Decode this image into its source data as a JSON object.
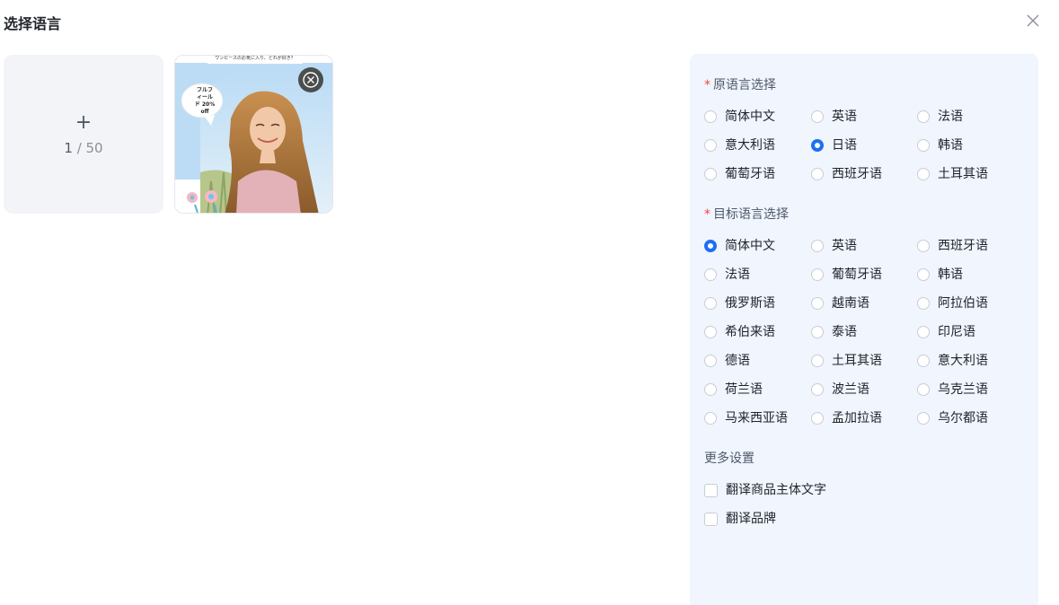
{
  "dialog": {
    "title": "选择语言"
  },
  "upload": {
    "plus": "+",
    "count_current": "1",
    "separator": " / ",
    "count_max": "50"
  },
  "thumbnail": {
    "top_text": "ワンピースのお気に入り、どれが好き？",
    "bubble_lines": [
      "フルフ",
      "ィール",
      "ド 20%",
      "off"
    ]
  },
  "source_language": {
    "required_mark": "*",
    "label": "原语言选择",
    "selected": "日语",
    "options": [
      "简体中文",
      "英语",
      "法语",
      "意大利语",
      "日语",
      "韩语",
      "葡萄牙语",
      "西班牙语",
      "土耳其语"
    ]
  },
  "target_language": {
    "required_mark": "*",
    "label": "目标语言选择",
    "selected": "简体中文",
    "options": [
      "简体中文",
      "英语",
      "西班牙语",
      "法语",
      "葡萄牙语",
      "韩语",
      "俄罗斯语",
      "越南语",
      "阿拉伯语",
      "希伯来语",
      "泰语",
      "印尼语",
      "德语",
      "土耳其语",
      "意大利语",
      "荷兰语",
      "波兰语",
      "乌克兰语",
      "马来西亚语",
      "孟加拉语",
      "乌尔都语"
    ]
  },
  "more_settings": {
    "label": "更多设置",
    "options": [
      {
        "label": "翻译商品主体文字",
        "checked": false
      },
      {
        "label": "翻译品牌",
        "checked": false
      }
    ]
  },
  "colors": {
    "accent": "#1d6ff2",
    "required": "#f5453b",
    "panel_bg": "#f0f5fe"
  }
}
